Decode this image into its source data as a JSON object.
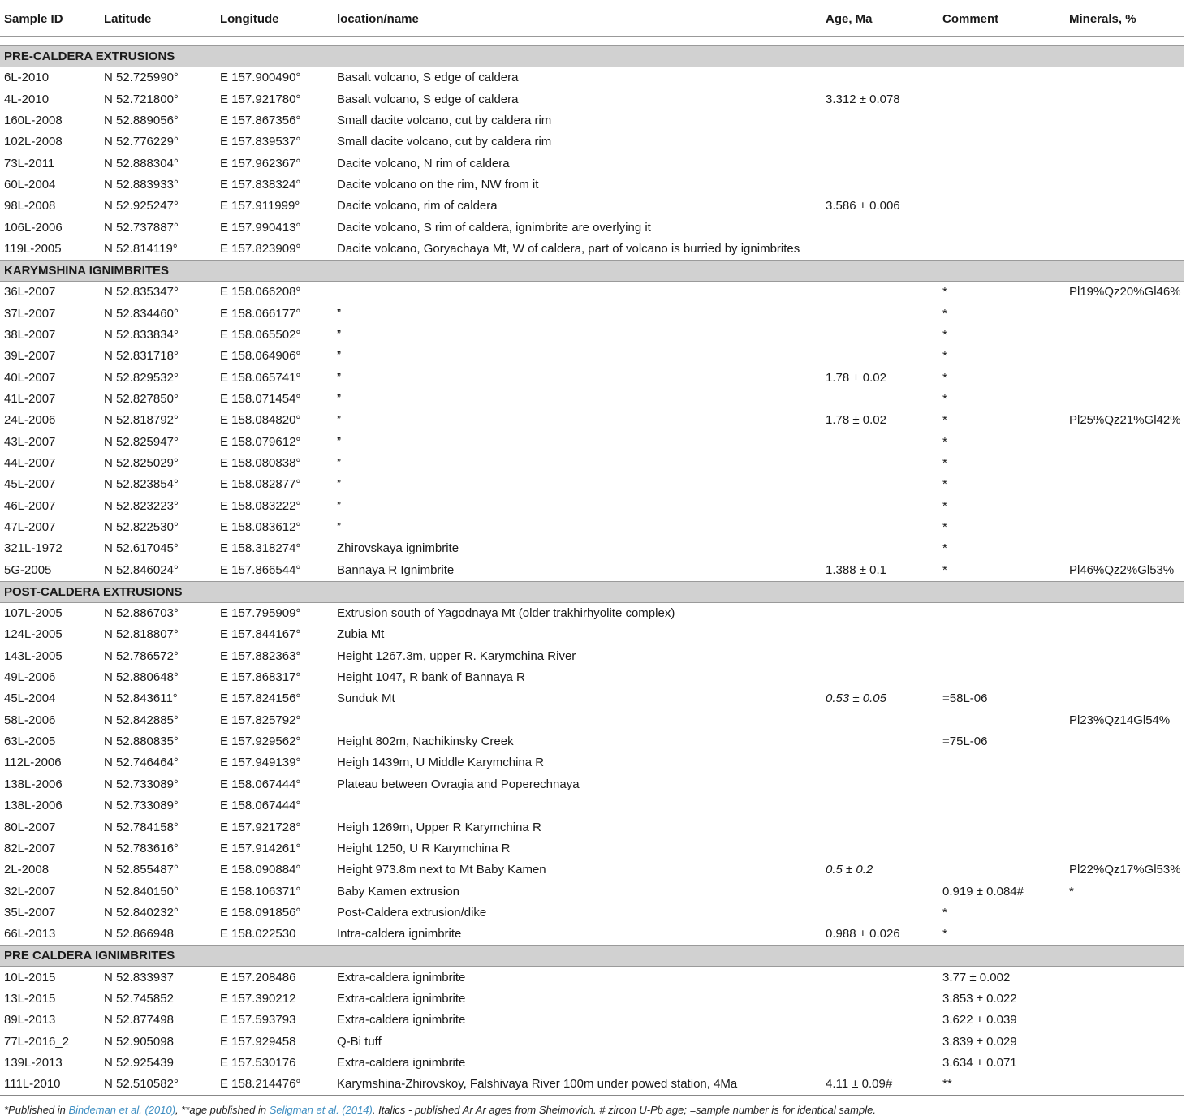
{
  "headers": [
    "Sample ID",
    "Latitude",
    "Longitude",
    "location/name",
    "Age, Ma",
    "Comment",
    "Minerals, %"
  ],
  "sections": [
    {
      "title": "PRE-CALDERA EXTRUSIONS",
      "rows": [
        [
          "6L-2010",
          "N 52.725990°",
          "E 157.900490°",
          "Basalt volcano, S edge of caldera",
          "",
          "",
          ""
        ],
        [
          "4L-2010",
          "N 52.721800°",
          "E 157.921780°",
          "Basalt volcano, S edge of caldera",
          "3.312 ± 0.078",
          "",
          ""
        ],
        [
          "160L-2008",
          "N 52.889056°",
          "E 157.867356°",
          "Small dacite volcano, cut by caldera rim",
          "",
          "",
          ""
        ],
        [
          "102L-2008",
          "N 52.776229°",
          "E 157.839537°",
          "Small dacite volcano, cut by caldera rim",
          "",
          "",
          ""
        ],
        [
          "73L-2011",
          "N 52.888304°",
          "E 157.962367°",
          "Dacite volcano, N rim of caldera",
          "",
          "",
          ""
        ],
        [
          "60L-2004",
          "N 52.883933°",
          "E 157.838324°",
          "Dacite volcano on the rim, NW from it",
          "",
          "",
          ""
        ],
        [
          "98L-2008",
          "N 52.925247°",
          "E 157.911999°",
          "Dacite volcano, rim of caldera",
          "3.586 ± 0.006",
          "",
          ""
        ],
        [
          "106L-2006",
          "N 52.737887°",
          "E 157.990413°",
          "Dacite volcano, S rim of caldera, ignimbrite are overlying it",
          "",
          "",
          ""
        ],
        [
          "119L-2005",
          "N 52.814119°",
          "E 157.823909°",
          "Dacite volcano, Goryachaya Mt, W of caldera, part of volcano is burried by ignimbrites",
          "",
          "",
          ""
        ]
      ]
    },
    {
      "title": "KARYMSHINA IGNIMBRITES",
      "rows": [
        [
          "36L-2007",
          "N 52.835347°",
          "E 158.066208°",
          "",
          "",
          "*",
          "Pl19%Qz20%Gl46%"
        ],
        [
          "37L-2007",
          "N 52.834460°",
          "E 158.066177°",
          "”",
          "",
          "*",
          ""
        ],
        [
          "38L-2007",
          "N 52.833834°",
          "E 158.065502°",
          "”",
          "",
          "*",
          ""
        ],
        [
          "39L-2007",
          "N 52.831718°",
          "E 158.064906°",
          "”",
          "",
          "*",
          ""
        ],
        [
          "40L-2007",
          "N 52.829532°",
          "E 158.065741°",
          "”",
          "1.78 ± 0.02",
          "*",
          ""
        ],
        [
          "41L-2007",
          "N 52.827850°",
          "E 158.071454°",
          "”",
          "",
          "*",
          ""
        ],
        [
          "24L-2006",
          "N 52.818792°",
          "E 158.084820°",
          "”",
          "1.78 ± 0.02",
          "*",
          "Pl25%Qz21%Gl42%"
        ],
        [
          "43L-2007",
          "N 52.825947°",
          "E 158.079612°",
          "”",
          "",
          "*",
          ""
        ],
        [
          "44L-2007",
          "N 52.825029°",
          "E 158.080838°",
          "”",
          "",
          "*",
          ""
        ],
        [
          "45L-2007",
          "N 52.823854°",
          "E 158.082877°",
          "”",
          "",
          "*",
          ""
        ],
        [
          "46L-2007",
          "N 52.823223°",
          "E 158.083222°",
          "”",
          "",
          "*",
          ""
        ],
        [
          "47L-2007",
          "N 52.822530°",
          "E 158.083612°",
          "”",
          "",
          "*",
          ""
        ],
        [
          "321L-1972",
          "N 52.617045°",
          "E 158.318274°",
          "Zhirovskaya ignimbrite",
          "",
          "*",
          ""
        ],
        [
          "5G-2005",
          "N 52.846024°",
          "E 157.866544°",
          "Bannaya R Ignimbrite",
          "1.388 ± 0.1",
          "*",
          "Pl46%Qz2%Gl53%"
        ]
      ]
    },
    {
      "title": "POST-CALDERA EXTRUSIONS",
      "rows": [
        [
          "107L-2005",
          "N 52.886703°",
          "E 157.795909°",
          "Extrusion south of Yagodnaya Mt (older trakhirhyolite complex)",
          "",
          "",
          ""
        ],
        [
          "124L-2005",
          "N 52.818807°",
          "E 157.844167°",
          "Zubia Mt",
          "",
          "",
          ""
        ],
        [
          "143L-2005",
          "N 52.786572°",
          "E 157.882363°",
          "Height 1267.3m, upper R. Karymchina River",
          "",
          "",
          ""
        ],
        [
          "49L-2006",
          "N 52.880648°",
          "E 157.868317°",
          "Height 1047, R bank of Bannaya R",
          "",
          "",
          ""
        ],
        [
          "45L-2004",
          "N 52.843611°",
          "E 157.824156°",
          "Sunduk Mt",
          "0.53 ± 0.05",
          "=58L-06",
          ""
        ],
        [
          "58L-2006",
          "N 52.842885°",
          "E 157.825792°",
          "",
          "",
          "",
          "Pl23%Qz14Gl54%"
        ],
        [
          "63L-2005",
          "N 52.880835°",
          "E 157.929562°",
          "Height 802m, Nachikinsky Creek",
          "",
          "=75L-06",
          ""
        ],
        [
          "112L-2006",
          "N 52.746464°",
          "E 157.949139°",
          "Heigh 1439m, U Middle Karymchina R",
          "",
          "",
          ""
        ],
        [
          "138L-2006",
          "N 52.733089°",
          "E 158.067444°",
          "Plateau between Ovragia and Poperechnaya",
          "",
          "",
          ""
        ],
        [
          "138L-2006",
          "N 52.733089°",
          "E 158.067444°",
          "",
          "",
          "",
          ""
        ],
        [
          "80L-2007",
          "N 52.784158°",
          "E 157.921728°",
          "Heigh 1269m, Upper R Karymchina R",
          "",
          "",
          ""
        ],
        [
          "82L-2007",
          "N 52.783616°",
          "E 157.914261°",
          "Height 1250, U R Karymchina R",
          "",
          "",
          ""
        ],
        [
          "2L-2008",
          "N 52.855487°",
          "E 158.090884°",
          "Height 973.8m next to Mt Baby Kamen",
          "0.5 ± 0.2",
          "",
          "Pl22%Qz17%Gl53%"
        ],
        [
          "32L-2007",
          "N 52.840150°",
          "E 158.106371°",
          "Baby Kamen extrusion",
          "",
          "0.919 ± 0.084#",
          "*"
        ],
        [
          "35L-2007",
          "N 52.840232°",
          "E 158.091856°",
          "Post-Caldera extrusion/dike",
          "",
          "*",
          ""
        ],
        [
          "66L-2013",
          "N 52.866948",
          "E 158.022530",
          "Intra-caldera ignimbrite",
          "0.988 ± 0.026",
          "*",
          ""
        ]
      ]
    },
    {
      "title": "PRE CALDERA IGNIMBRITES",
      "rows": [
        [
          "10L-2015",
          "N 52.833937",
          "E 157.208486",
          "Extra-caldera ignimbrite",
          "",
          "3.77 ± 0.002",
          ""
        ],
        [
          "13L-2015",
          "N 52.745852",
          "E 157.390212",
          "Extra-caldera ignimbrite",
          "",
          "3.853 ± 0.022",
          ""
        ],
        [
          "89L-2013",
          "N 52.877498",
          "E 157.593793",
          "Extra-caldera ignimbrite",
          "",
          "3.622 ± 0.039",
          ""
        ],
        [
          "77L-2016_2",
          "N 52.905098",
          "E 157.929458",
          "Q-Bi tuff",
          "",
          "3.839 ± 0.029",
          ""
        ],
        [
          "139L-2013",
          "N 52.925439",
          "E 157.530176",
          "Extra-caldera ignimbrite",
          "",
          "3.634 ± 0.071",
          ""
        ],
        [
          "111L-2010",
          "N 52.510582°",
          "E 158.214476°",
          "Karymshina-Zhirovskoy, Falshivaya River 100m under powed station, 4Ma",
          "4.11 ± 0.09#",
          "**",
          ""
        ]
      ]
    }
  ],
  "italic_ages": [
    "0.53 ± 0.05",
    "0.5 ± 0.2"
  ],
  "footnote": {
    "part1": "*Published in ",
    "link1": "Bindeman et al. (2010)",
    "part2": ", **age published in ",
    "link2": "Seligman et al. (2014)",
    "part3": ". Italics - published Ar Ar ages from Sheimovich. # zircon U-Pb age; =sample number is for identical sample.",
    "link_color": "#3e8ec2"
  }
}
